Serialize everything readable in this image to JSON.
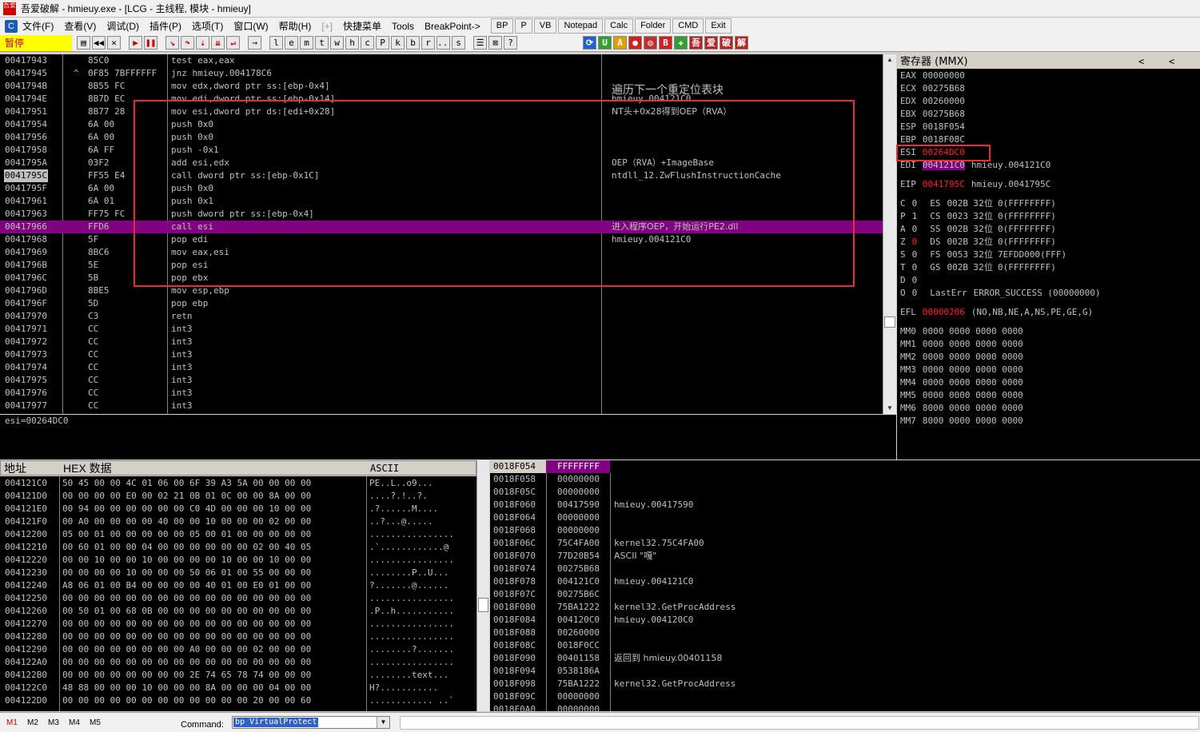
{
  "window": {
    "title": "吾爱破解 - hmieuy.exe - [LCG - 主线程, 模块 - hmieuy]",
    "icon_label": "吾爱"
  },
  "menu": {
    "logo": "C",
    "items": [
      "文件(F)",
      "查看(V)",
      "调试(D)",
      "插件(P)",
      "选项(T)",
      "窗口(W)",
      "帮助(H)"
    ],
    "dim_item": "[+]",
    "extra": [
      "快捷菜单",
      "Tools",
      "BreakPoint->"
    ],
    "buttons": [
      "BP",
      "P",
      "VB",
      "Notepad",
      "Calc",
      "Folder",
      "CMD",
      "Exit"
    ]
  },
  "toolbar": {
    "status": "暂停",
    "letters": [
      "l",
      "e",
      "m",
      "t",
      "w",
      "h",
      "c",
      "P",
      "k",
      "b",
      "r",
      "...",
      "s"
    ]
  },
  "disasm": {
    "rows": [
      {
        "addr": "00417943",
        "mark": "",
        "hex": "85C0",
        "asm": "test eax,eax",
        "cmt": ""
      },
      {
        "addr": "00417945",
        "mark": "^",
        "hex": "0F85 7BFFFFFF",
        "asm": "jnz hmieuy.004178C6",
        "cmt": ""
      },
      {
        "addr": "0041794B",
        "mark": "",
        "hex": "8B55 FC",
        "asm": "mov edx,dword ptr ss:[ebp-0x4]",
        "cmt": ""
      },
      {
        "addr": "0041794E",
        "mark": "",
        "hex": "8B7D EC",
        "asm": "mov edi,dword ptr ss:[ebp-0x14]",
        "cmt": "hmieuy.004121C0"
      },
      {
        "addr": "00417951",
        "mark": "",
        "hex": "8B77 28",
        "asm": "mov esi,dword ptr ds:[edi+0x28]",
        "cmt": "NT头+0x28得到OEP（RVA）"
      },
      {
        "addr": "00417954",
        "mark": "",
        "hex": "6A 00",
        "asm": "push 0x0",
        "cmt": ""
      },
      {
        "addr": "00417956",
        "mark": "",
        "hex": "6A 00",
        "asm": "push 0x0",
        "cmt": ""
      },
      {
        "addr": "00417958",
        "mark": "",
        "hex": "6A FF",
        "asm": "push -0x1",
        "cmt": ""
      },
      {
        "addr": "0041795A",
        "mark": "",
        "hex": "03F2",
        "asm": "add esi,edx",
        "cmt": "OEP（RVA）+ImageBase"
      },
      {
        "addr": "0041795C",
        "mark": "",
        "hex": "FF55 E4",
        "asm": "call dword ptr ss:[ebp-0x1C]",
        "cmt": "ntdll_12.ZwFlushInstructionCache"
      },
      {
        "addr": "0041795F",
        "mark": "",
        "hex": "6A 00",
        "asm": "push 0x0",
        "cmt": ""
      },
      {
        "addr": "00417961",
        "mark": "",
        "hex": "6A 01",
        "asm": "push 0x1",
        "cmt": ""
      },
      {
        "addr": "00417963",
        "mark": "",
        "hex": "FF75 FC",
        "asm": "push dword ptr ss:[ebp-0x4]",
        "cmt": ""
      },
      {
        "addr": "00417966",
        "mark": "",
        "hex": "FFD6",
        "asm": "call esi",
        "cmt": "进入程序OEP，开始运行PE2.dll"
      },
      {
        "addr": "00417968",
        "mark": "",
        "hex": "5F",
        "asm": "pop edi",
        "cmt": "hmieuy.004121C0"
      },
      {
        "addr": "00417969",
        "mark": "",
        "hex": "8BC6",
        "asm": "mov eax,esi",
        "cmt": ""
      },
      {
        "addr": "0041796B",
        "mark": "",
        "hex": "5E",
        "asm": "pop esi",
        "cmt": ""
      },
      {
        "addr": "0041796C",
        "mark": "",
        "hex": "5B",
        "asm": "pop ebx",
        "cmt": ""
      },
      {
        "addr": "0041796D",
        "mark": "",
        "hex": "8BE5",
        "asm": "mov esp,ebp",
        "cmt": ""
      },
      {
        "addr": "0041796F",
        "mark": "",
        "hex": "5D",
        "asm": "pop ebp",
        "cmt": ""
      },
      {
        "addr": "00417970",
        "mark": "",
        "hex": "C3",
        "asm": "retn",
        "cmt": ""
      },
      {
        "addr": "00417971",
        "mark": "",
        "hex": "CC",
        "asm": "int3",
        "cmt": ""
      },
      {
        "addr": "00417972",
        "mark": "",
        "hex": "CC",
        "asm": "int3",
        "cmt": ""
      },
      {
        "addr": "00417973",
        "mark": "",
        "hex": "CC",
        "asm": "int3",
        "cmt": ""
      },
      {
        "addr": "00417974",
        "mark": "",
        "hex": "CC",
        "asm": "int3",
        "cmt": ""
      },
      {
        "addr": "00417975",
        "mark": "",
        "hex": "CC",
        "asm": "int3",
        "cmt": ""
      },
      {
        "addr": "00417976",
        "mark": "",
        "hex": "CC",
        "asm": "int3",
        "cmt": ""
      },
      {
        "addr": "00417977",
        "mark": "",
        "hex": "CC",
        "asm": "int3",
        "cmt": ""
      }
    ],
    "header_comment": "遍历下一个重定位表块",
    "selected_index": 9,
    "highlight_index": 13
  },
  "info": {
    "text": "esi=00264DC0"
  },
  "registers": {
    "title": "寄存器 (MMX)",
    "nav_left": "<",
    "nav_right": "<",
    "gp": [
      {
        "n": "EAX",
        "v": "00000000",
        "c": ""
      },
      {
        "n": "ECX",
        "v": "00275B68",
        "c": ""
      },
      {
        "n": "EDX",
        "v": "00260000",
        "c": ""
      },
      {
        "n": "EBX",
        "v": "00275B68",
        "c": ""
      },
      {
        "n": "ESP",
        "v": "0018F054",
        "c": ""
      },
      {
        "n": "EBP",
        "v": "0018F08C",
        "c": ""
      },
      {
        "n": "ESI",
        "v": "00264DC0",
        "c": ""
      },
      {
        "n": "EDI",
        "v": "004121C0",
        "c": "hmieuy.004121C0"
      }
    ],
    "eip": {
      "n": "EIP",
      "v": "0041795C",
      "c": "hmieuy.0041795C"
    },
    "seg": [
      {
        "f": "C",
        "fv": "0",
        "s": "ES",
        "sv": "002B",
        "b": "32位",
        "r": "0(FFFFFFFF)"
      },
      {
        "f": "P",
        "fv": "1",
        "s": "CS",
        "sv": "0023",
        "b": "32位",
        "r": "0(FFFFFFFF)"
      },
      {
        "f": "A",
        "fv": "0",
        "s": "SS",
        "sv": "002B",
        "b": "32位",
        "r": "0(FFFFFFFF)"
      },
      {
        "f": "Z",
        "fv": "0",
        "s": "DS",
        "sv": "002B",
        "b": "32位",
        "r": "0(FFFFFFFF)"
      },
      {
        "f": "S",
        "fv": "0",
        "s": "FS",
        "sv": "0053",
        "b": "32位",
        "r": "7EFDD000(FFF)"
      },
      {
        "f": "T",
        "fv": "0",
        "s": "GS",
        "sv": "002B",
        "b": "32位",
        "r": "0(FFFFFFFF)"
      }
    ],
    "d": {
      "f": "D",
      "fv": "0"
    },
    "o": {
      "f": "O",
      "fv": "0",
      "label": "LastErr",
      "value": "ERROR_SUCCESS (00000000)"
    },
    "efl": {
      "n": "EFL",
      "v": "00000206",
      "c": "(NO,NB,NE,A,NS,PE,GE,G)"
    },
    "mm": [
      {
        "n": "MM0",
        "v": "0000 0000 0000 0000"
      },
      {
        "n": "MM1",
        "v": "0000 0000 0000 0000"
      },
      {
        "n": "MM2",
        "v": "0000 0000 0000 0000"
      },
      {
        "n": "MM3",
        "v": "0000 0000 0000 0000"
      },
      {
        "n": "MM4",
        "v": "0000 0000 0000 0000"
      },
      {
        "n": "MM5",
        "v": "0000 0000 0000 0000"
      },
      {
        "n": "MM6",
        "v": "8000 0000 0000 0000"
      },
      {
        "n": "MM7",
        "v": "8000 0000 0000 0000"
      }
    ]
  },
  "dump": {
    "headers": {
      "addr": "地址",
      "hex": "HEX 数据",
      "ascii": "ASCII"
    },
    "rows": [
      {
        "a": "004121C0",
        "h": "50 45 00 00 4C 01 06 00 6F 39 A3 5A 00 00 00 00",
        "s": "PE..L..o9..."
      },
      {
        "a": "004121D0",
        "h": "00 00 00 00 E0 00 02 21 0B 01 0C 00 00 8A 00 00",
        "s": "....?.!..?."
      },
      {
        "a": "004121E0",
        "h": "00 94 00 00 00 00 00 00 C0 4D 00 00 00 10 00 00",
        "s": ".?......M...."
      },
      {
        "a": "004121F0",
        "h": "00 A0 00 00 00 00 40 00 00 10 00 00 00 02 00 00",
        "s": "..?...@....."
      },
      {
        "a": "00412200",
        "h": "05 00 01 00 00 00 00 00 05 00 01 00 00 00 00 00",
        "s": "................"
      },
      {
        "a": "00412210",
        "h": "00 60 01 00 00 04 00 00 00 00 00 00 02 00 40 05",
        "s": ".`............@"
      },
      {
        "a": "00412220",
        "h": "00 00 10 00 00 10 00 00 00 00 10 00 00 10 00 00",
        "s": "................"
      },
      {
        "a": "00412230",
        "h": "00 00 00 00 10 00 00 00 50 06 01 00 55 00 00 00",
        "s": "........P..U..."
      },
      {
        "a": "00412240",
        "h": "A8 06 01 00 B4 00 00 00 00 40 01 00 E0 01 00 00",
        "s": "?.......@......"
      },
      {
        "a": "00412250",
        "h": "00 00 00 00 00 00 00 00 00 00 00 00 00 00 00 00",
        "s": "................"
      },
      {
        "a": "00412260",
        "h": "00 50 01 00 68 0B 00 00 00 00 00 00 00 00 00 00",
        "s": ".P..h..........."
      },
      {
        "a": "00412270",
        "h": "00 00 00 00 00 00 00 00 00 00 00 00 00 00 00 00",
        "s": "................"
      },
      {
        "a": "00412280",
        "h": "00 00 00 00 00 00 00 00 00 00 00 00 00 00 00 00",
        "s": "................"
      },
      {
        "a": "00412290",
        "h": "00 00 00 00 00 00 00 00 A0 00 00 00 02 00 00 00",
        "s": "........?......."
      },
      {
        "a": "004122A0",
        "h": "00 00 00 00 00 00 00 00 00 00 00 00 00 00 00 00",
        "s": "................"
      },
      {
        "a": "004122B0",
        "h": "00 00 00 00 00 00 00 00 2E 74 65 78 74 00 00 00",
        "s": "........text..."
      },
      {
        "a": "004122C0",
        "h": "48 88 00 00 00 10 00 00 00 8A 00 00 00 04 00 00",
        "s": "H?..........."
      },
      {
        "a": "004122D0",
        "h": "00 00 00 00 00 00 00 00 00 00 00 00 20 00 00 60",
        "s": "............ ..`"
      }
    ]
  },
  "stack": {
    "rows": [
      {
        "a": "0018F054",
        "v": "FFFFFFFF",
        "c": ""
      },
      {
        "a": "0018F058",
        "v": "00000000",
        "c": ""
      },
      {
        "a": "0018F05C",
        "v": "00000000",
        "c": ""
      },
      {
        "a": "0018F060",
        "v": "00417590",
        "c": "hmieuy.00417590"
      },
      {
        "a": "0018F064",
        "v": "00000000",
        "c": ""
      },
      {
        "a": "0018F068",
        "v": "00000000",
        "c": ""
      },
      {
        "a": "0018F06C",
        "v": "75C4FA00",
        "c": "kernel32.75C4FA00"
      },
      {
        "a": "0018F070",
        "v": "77D20B54",
        "c": "ASCII \"嘎\""
      },
      {
        "a": "0018F074",
        "v": "00275B68",
        "c": ""
      },
      {
        "a": "0018F078",
        "v": "004121C0",
        "c": "hmieuy.004121C0"
      },
      {
        "a": "0018F07C",
        "v": "00275B6C",
        "c": ""
      },
      {
        "a": "0018F080",
        "v": "75BA1222",
        "c": "kernel32.GetProcAddress"
      },
      {
        "a": "0018F084",
        "v": "004120C0",
        "c": "hmieuy.004120C0"
      },
      {
        "a": "0018F088",
        "v": "00260000",
        "c": ""
      },
      {
        "a": "0018F08C",
        "v": "0018F0CC",
        "c": ""
      },
      {
        "a": "0018F090",
        "v": "00401158",
        "c": "返回到 hmieuy.00401158"
      },
      {
        "a": "0018F094",
        "v": "0538186A",
        "c": ""
      },
      {
        "a": "0018F098",
        "v": "75BA1222",
        "c": "kernel32.GetProcAddress"
      },
      {
        "a": "0018F09C",
        "v": "00000000",
        "c": ""
      },
      {
        "a": "0018F0A0",
        "v": "00000000",
        "c": ""
      }
    ]
  },
  "bottom": {
    "tabs": [
      "M1",
      "M2",
      "M3",
      "M4",
      "M5"
    ],
    "command_label": "Command:",
    "command_value": "bp VirtualProtect"
  }
}
